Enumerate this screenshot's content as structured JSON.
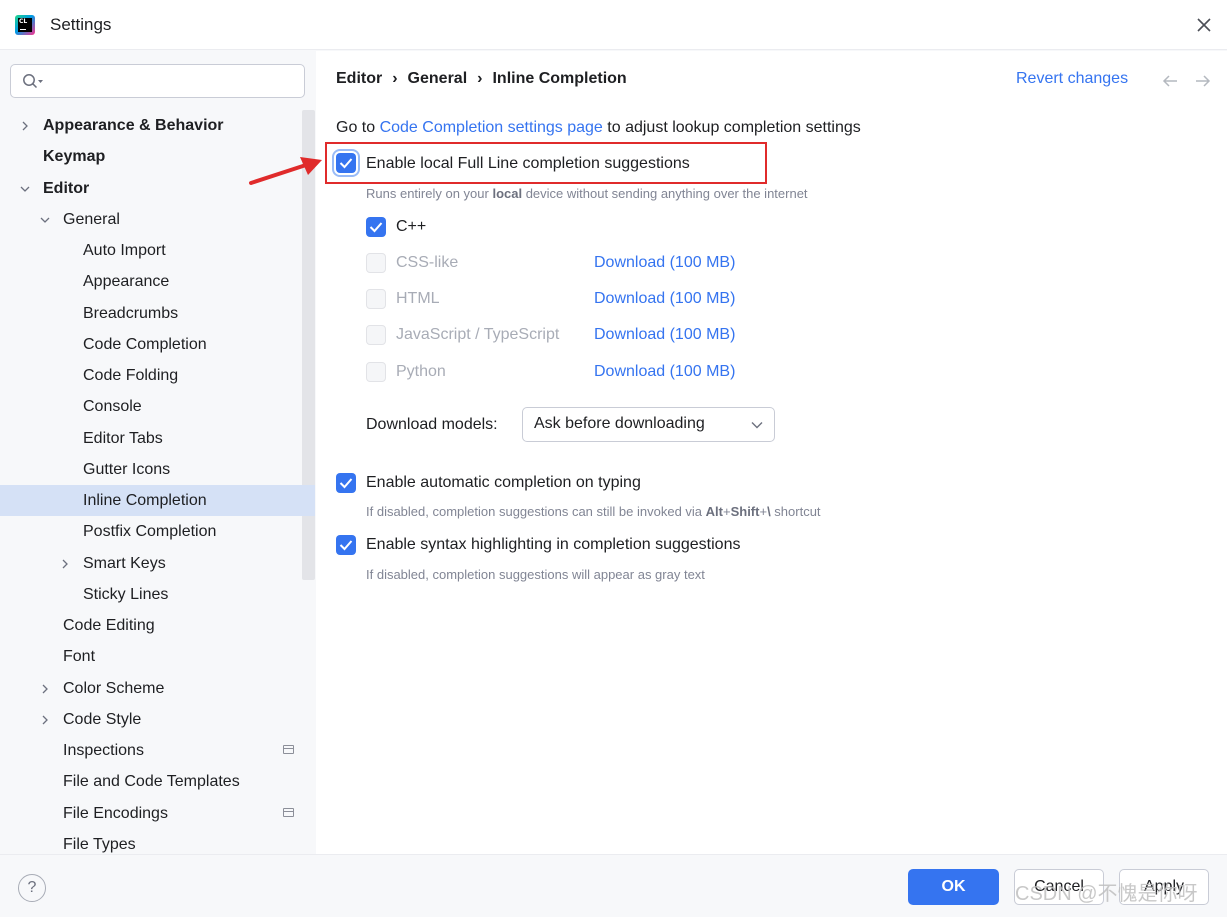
{
  "window": {
    "title": "Settings"
  },
  "search": {
    "placeholder": ""
  },
  "sidebar": {
    "items": [
      {
        "label": "Appearance & Behavior",
        "level": 0,
        "bold": true,
        "expander": "collapsed"
      },
      {
        "label": "Keymap",
        "level": 0,
        "bold": true,
        "expander": "none"
      },
      {
        "label": "Editor",
        "level": 0,
        "bold": true,
        "expander": "expanded"
      },
      {
        "label": "General",
        "level": 1,
        "bold": false,
        "expander": "expanded"
      },
      {
        "label": "Auto Import",
        "level": 2,
        "bold": false,
        "expander": "none"
      },
      {
        "label": "Appearance",
        "level": 2,
        "bold": false,
        "expander": "none"
      },
      {
        "label": "Breadcrumbs",
        "level": 2,
        "bold": false,
        "expander": "none"
      },
      {
        "label": "Code Completion",
        "level": 2,
        "bold": false,
        "expander": "none"
      },
      {
        "label": "Code Folding",
        "level": 2,
        "bold": false,
        "expander": "none"
      },
      {
        "label": "Console",
        "level": 2,
        "bold": false,
        "expander": "none"
      },
      {
        "label": "Editor Tabs",
        "level": 2,
        "bold": false,
        "expander": "none"
      },
      {
        "label": "Gutter Icons",
        "level": 2,
        "bold": false,
        "expander": "none"
      },
      {
        "label": "Inline Completion",
        "level": 2,
        "bold": false,
        "expander": "none",
        "selected": true
      },
      {
        "label": "Postfix Completion",
        "level": 2,
        "bold": false,
        "expander": "none"
      },
      {
        "label": "Smart Keys",
        "level": 2,
        "bold": false,
        "expander": "collapsed"
      },
      {
        "label": "Sticky Lines",
        "level": 2,
        "bold": false,
        "expander": "none"
      },
      {
        "label": "Code Editing",
        "level": 1,
        "bold": false,
        "expander": "none"
      },
      {
        "label": "Font",
        "level": 1,
        "bold": false,
        "expander": "none"
      },
      {
        "label": "Color Scheme",
        "level": 1,
        "bold": false,
        "expander": "collapsed"
      },
      {
        "label": "Code Style",
        "level": 1,
        "bold": false,
        "expander": "collapsed"
      },
      {
        "label": "Inspections",
        "level": 1,
        "bold": false,
        "expander": "none",
        "project_icon": true
      },
      {
        "label": "File and Code Templates",
        "level": 1,
        "bold": false,
        "expander": "none"
      },
      {
        "label": "File Encodings",
        "level": 1,
        "bold": false,
        "expander": "none",
        "project_icon": true
      },
      {
        "label": "File Types",
        "level": 1,
        "bold": false,
        "expander": "none"
      }
    ]
  },
  "breadcrumb": {
    "parts": [
      "Editor",
      "General",
      "Inline Completion"
    ],
    "separator": "›"
  },
  "header": {
    "revert_label": "Revert changes",
    "back_icon": "arrow-left-icon",
    "forward_icon": "arrow-right-icon"
  },
  "goto": {
    "prefix": "Go to ",
    "link": "Code Completion settings page",
    "suffix": " to adjust lookup completion settings"
  },
  "full_line": {
    "label": "Enable local Full Line completion suggestions",
    "checked": true,
    "hint_prefix": "Runs entirely on your ",
    "hint_bold": "local",
    "hint_suffix": " device without sending anything over the internet"
  },
  "languages": [
    {
      "name": "C++",
      "checked": true,
      "enabled": true,
      "download": ""
    },
    {
      "name": "CSS-like",
      "checked": false,
      "enabled": false,
      "download": "Download (100 MB)"
    },
    {
      "name": "HTML",
      "checked": false,
      "enabled": false,
      "download": "Download (100 MB)"
    },
    {
      "name": "JavaScript / TypeScript",
      "checked": false,
      "enabled": false,
      "download": "Download (100 MB)"
    },
    {
      "name": "Python",
      "checked": false,
      "enabled": false,
      "download": "Download (100 MB)"
    }
  ],
  "download_models": {
    "label": "Download models:",
    "value": "Ask before downloading"
  },
  "auto_completion": {
    "label": "Enable automatic completion on typing",
    "checked": true,
    "hint_prefix": "If disabled, completion suggestions can still be invoked via ",
    "hint_keys": [
      "Alt",
      "Shift",
      "\\"
    ],
    "hint_suffix": " shortcut"
  },
  "syntax_highlighting": {
    "label": "Enable syntax highlighting in completion suggestions",
    "checked": true,
    "hint": "If disabled, completion suggestions will appear as gray text"
  },
  "footer": {
    "help_label": "?",
    "ok_label": "OK",
    "cancel_label": "Cancel",
    "apply_label": "Apply"
  },
  "watermark": "CSDN @不愧是你呀",
  "colors": {
    "accent": "#3574f0",
    "selection": "#d5e1f6",
    "annotation_red": "#e02b2b"
  }
}
